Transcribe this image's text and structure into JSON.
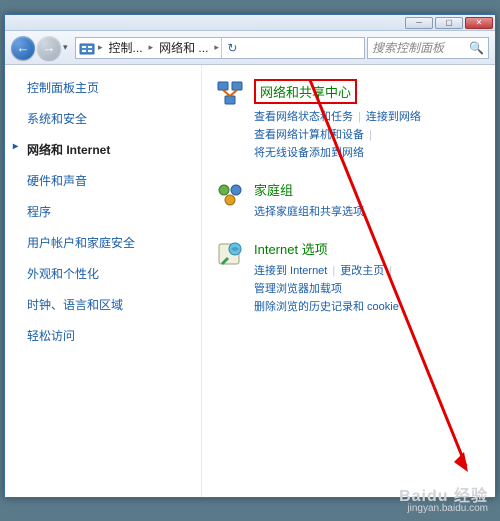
{
  "window_buttons": {
    "min": "─",
    "max": "▢",
    "close": "✕"
  },
  "nav": {
    "back": "←",
    "forward": "→",
    "dropdown": "▾",
    "refresh": "↻"
  },
  "breadcrumb": {
    "segments": [
      "控制...",
      "网络和 ..."
    ],
    "arrow": "▸"
  },
  "search": {
    "placeholder": "搜索控制面板",
    "icon": "🔍"
  },
  "sidebar": {
    "title": "控制面板主页",
    "items": [
      {
        "label": "系统和安全",
        "active": false
      },
      {
        "label": "网络和 Internet",
        "active": true
      },
      {
        "label": "硬件和声音",
        "active": false
      },
      {
        "label": "程序",
        "active": false
      },
      {
        "label": "用户帐户和家庭安全",
        "active": false
      },
      {
        "label": "外观和个性化",
        "active": false
      },
      {
        "label": "时钟、语言和区域",
        "active": false
      },
      {
        "label": "轻松访问",
        "active": false
      }
    ]
  },
  "main": {
    "sections": [
      {
        "title": "网络和共享中心",
        "highlighted": true,
        "links": [
          [
            "查看网络状态和任务",
            "连接到网络"
          ],
          [
            "查看网络计算机和设备",
            "将无线设备添加到网络"
          ]
        ]
      },
      {
        "title": "家庭组",
        "highlighted": false,
        "links": [
          [
            "选择家庭组和共享选项"
          ]
        ]
      },
      {
        "title": "Internet 选项",
        "highlighted": false,
        "links": [
          [
            "连接到 Internet",
            "更改主页",
            "管理浏览器加载项"
          ],
          [
            "删除浏览的历史记录和 cookie"
          ]
        ]
      }
    ]
  },
  "watermark": {
    "brand": "Baidu 经验",
    "url": "jingyan.baidu.com"
  }
}
